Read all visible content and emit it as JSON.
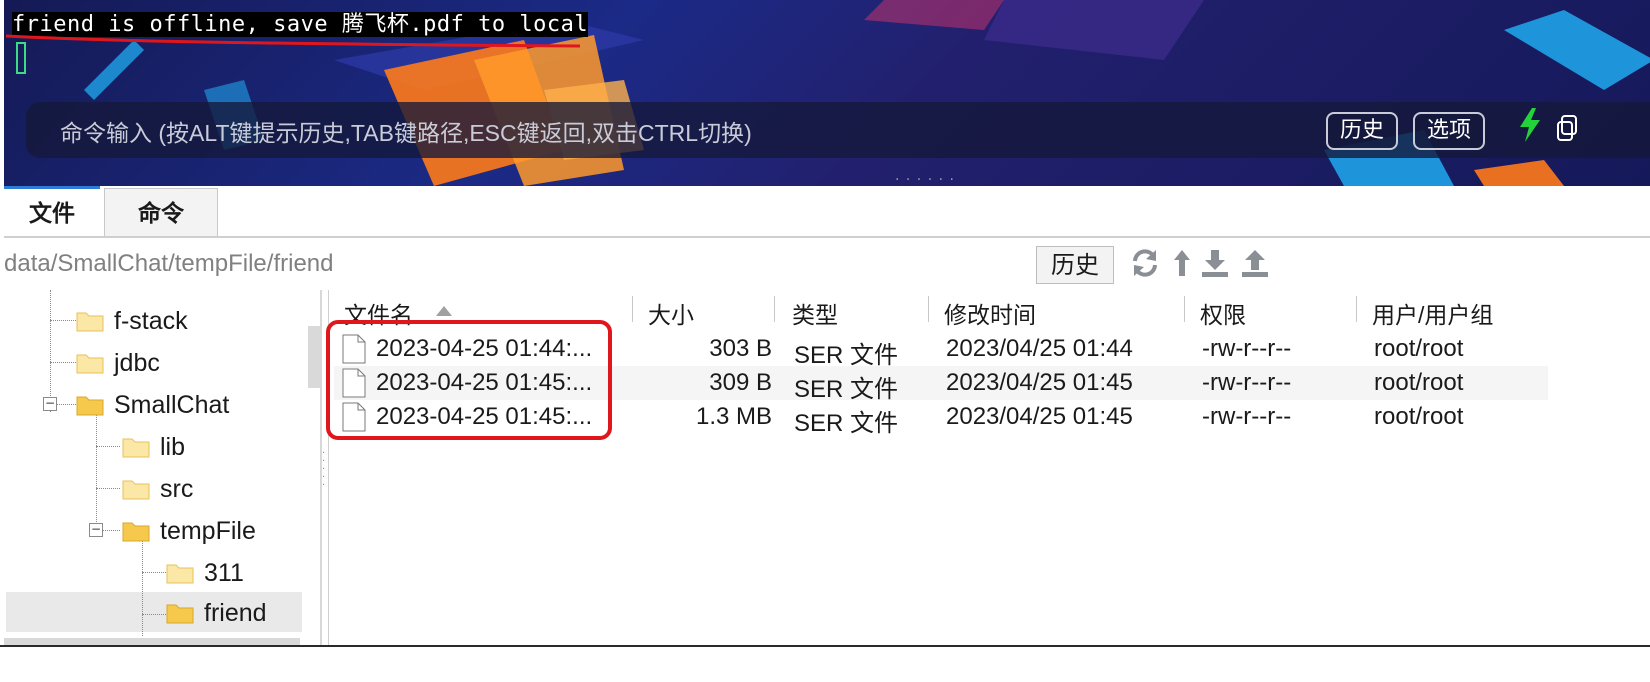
{
  "terminal": {
    "output_line": "friend is offline, save 腾飞杯.pdf to local",
    "command_placeholder": "命令输入 (按ALT键提示历史,TAB键路径,ESC键返回,双击CTRL切换)",
    "history_button": "历史",
    "options_button": "选项",
    "annotation_color": "#e0161d"
  },
  "tabs": [
    {
      "label": "文件",
      "active": true
    },
    {
      "label": "命令",
      "active": false
    }
  ],
  "path_bar": {
    "path": "data/SmallChat/tempFile/friend",
    "history_button": "历史",
    "icons": [
      "refresh-icon",
      "up-directory-icon",
      "download-icon",
      "upload-icon"
    ]
  },
  "tree": {
    "items": [
      {
        "label": "f-stack",
        "expanded": null
      },
      {
        "label": "jdbc",
        "expanded": null
      },
      {
        "label": "SmallChat",
        "expanded": true
      },
      {
        "label": "lib",
        "expanded": null
      },
      {
        "label": "src",
        "expanded": null
      },
      {
        "label": "tempFile",
        "expanded": true
      },
      {
        "label": "311",
        "expanded": null
      },
      {
        "label": "friend",
        "expanded": null,
        "selected": true
      }
    ]
  },
  "file_list": {
    "columns": [
      "文件名",
      "大小",
      "类型",
      "修改时间",
      "权限",
      "用户/用户组"
    ],
    "sort_column": "文件名",
    "rows": [
      {
        "name": "2023-04-25 01:44:...",
        "size": "303 B",
        "type": "SER 文件",
        "modified": "2023/04/25 01:44",
        "perms": "-rw-r--r--",
        "owner": "root/root"
      },
      {
        "name": "2023-04-25 01:45:...",
        "size": "309 B",
        "type": "SER 文件",
        "modified": "2023/04/25 01:45",
        "perms": "-rw-r--r--",
        "owner": "root/root"
      },
      {
        "name": "2023-04-25 01:45:...",
        "size": "1.3 MB",
        "type": "SER 文件",
        "modified": "2023/04/25 01:45",
        "perms": "-rw-r--r--",
        "owner": "root/root"
      }
    ]
  },
  "colors": {
    "accent": "#2f7cd7",
    "annotation": "#e0161d",
    "folder": "#f6c84c"
  }
}
